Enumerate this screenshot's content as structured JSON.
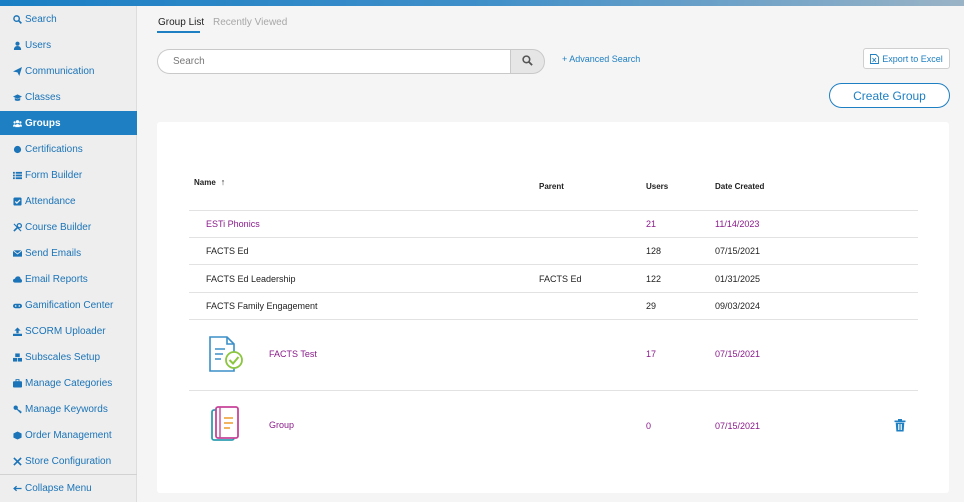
{
  "sidebar": {
    "items": [
      {
        "label": "Search",
        "icon": "search-icon"
      },
      {
        "label": "Users",
        "icon": "user-icon"
      },
      {
        "label": "Communication",
        "icon": "send-icon"
      },
      {
        "label": "Classes",
        "icon": "graduation-cap-icon"
      },
      {
        "label": "Groups",
        "icon": "users-icon",
        "active": true
      },
      {
        "label": "Certifications",
        "icon": "certificate-icon"
      },
      {
        "label": "Form Builder",
        "icon": "list-icon"
      },
      {
        "label": "Attendance",
        "icon": "check-square-icon"
      },
      {
        "label": "Course Builder",
        "icon": "wrench-icon"
      },
      {
        "label": "Send Emails",
        "icon": "envelope-icon"
      },
      {
        "label": "Email Reports",
        "icon": "cloud-icon"
      },
      {
        "label": "Gamification Center",
        "icon": "gamepad-icon"
      },
      {
        "label": "SCORM Uploader",
        "icon": "upload-icon"
      },
      {
        "label": "Subscales Setup",
        "icon": "cubes-icon"
      },
      {
        "label": "Manage Categories",
        "icon": "briefcase-icon"
      },
      {
        "label": "Manage Keywords",
        "icon": "key-icon"
      },
      {
        "label": "Order Management",
        "icon": "box-icon"
      },
      {
        "label": "Store Configuration",
        "icon": "tools-icon"
      }
    ],
    "collapse_label": "Collapse Menu"
  },
  "tabs": {
    "group_list": "Group List",
    "recently_viewed": "Recently Viewed"
  },
  "search": {
    "placeholder": "Search",
    "value": "",
    "advanced_label": "+ Advanced Search"
  },
  "actions": {
    "export_label": "Export to Excel",
    "create_label": "Create Group"
  },
  "table": {
    "headers": {
      "name": "Name",
      "sort_arrow": "↑",
      "parent": "Parent",
      "users": "Users",
      "date": "Date Created"
    },
    "rows": [
      {
        "name": "ESTi Phonics",
        "parent": "",
        "users": "21",
        "date": "11/14/2023",
        "link": true
      },
      {
        "name": "FACTS Ed",
        "parent": "",
        "users": "128",
        "date": "07/15/2021",
        "link": false
      },
      {
        "name": "FACTS Ed Leadership",
        "parent": "FACTS Ed",
        "users": "122",
        "date": "01/31/2025",
        "link": false
      },
      {
        "name": "FACTS Family Engagement",
        "parent": "",
        "users": "29",
        "date": "09/03/2024",
        "link": false
      },
      {
        "name": "FACTS Test",
        "parent": "",
        "users": "17",
        "date": "07/15/2021",
        "link": true,
        "icon": "document-check-icon"
      },
      {
        "name": "Group",
        "parent": "",
        "users": "0",
        "date": "07/15/2021",
        "link": true,
        "icon": "notebook-icon",
        "deletable": true
      }
    ]
  },
  "colors": {
    "accent": "#1e7fc2",
    "link_purple": "#8a1a8a",
    "sidebar_bg": "#eeeeee"
  }
}
